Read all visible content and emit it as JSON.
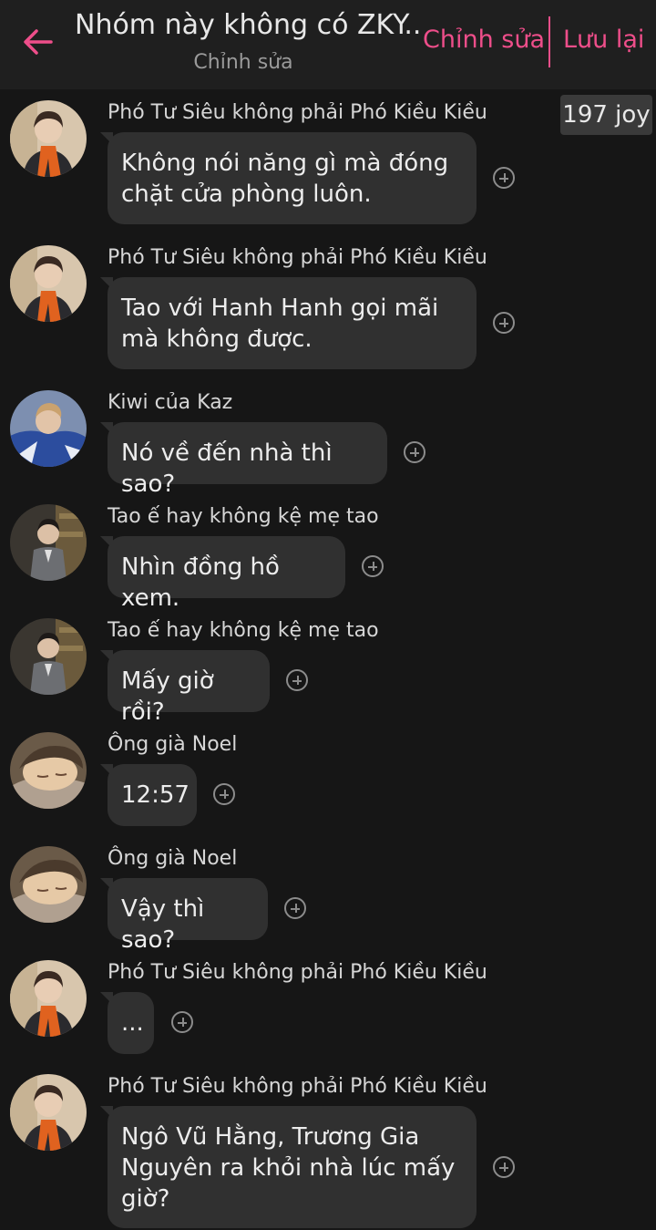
{
  "header": {
    "title": "Nhóm này không có ZKY...",
    "subtitle": "Chỉnh sửa",
    "edit_label": "Chỉnh sửa",
    "save_label": "Lưu lại",
    "accent_color": "#ee4e8a",
    "back_icon": "arrow-left-icon"
  },
  "joy_badge": "197 joy",
  "messages": [
    {
      "sender": "Phó Tư Siêu không phải Phó Kiều Kiều",
      "text": "Không nói năng gì mà đóng chặt cửa phòng luôn.",
      "avatar": "orange-scarf-avatar"
    },
    {
      "sender": "Phó Tư Siêu không phải Phó Kiều Kiều",
      "text": "Tao với Hanh Hanh gọi mãi mà không được.",
      "avatar": "orange-scarf-avatar"
    },
    {
      "sender": "Kiwi của Kaz",
      "text": "Nó về đến nhà thì sao?",
      "avatar": "blue-jacket-avatar"
    },
    {
      "sender": "Tao ế hay không kệ mẹ tao",
      "text": "Nhìn đồng hồ xem.",
      "avatar": "suit-avatar"
    },
    {
      "sender": "Tao ế hay không kệ mẹ tao",
      "text": "Mấy giờ rồi?",
      "avatar": "suit-avatar"
    },
    {
      "sender": "Ông già Noel",
      "text": "12:57",
      "avatar": "sleeping-avatar"
    },
    {
      "sender": "Ông già Noel",
      "text": "Vậy thì sao?",
      "avatar": "sleeping-avatar"
    },
    {
      "sender": "Phó Tư Siêu không phải Phó Kiều Kiều",
      "text": "...",
      "avatar": "orange-scarf-avatar"
    },
    {
      "sender": "Phó Tư Siêu không phải Phó Kiều Kiều",
      "text": "Ngô Vũ Hằng, Trương Gia Nguyên ra khỏi nhà lúc mấy giờ?",
      "avatar": "orange-scarf-avatar"
    }
  ]
}
